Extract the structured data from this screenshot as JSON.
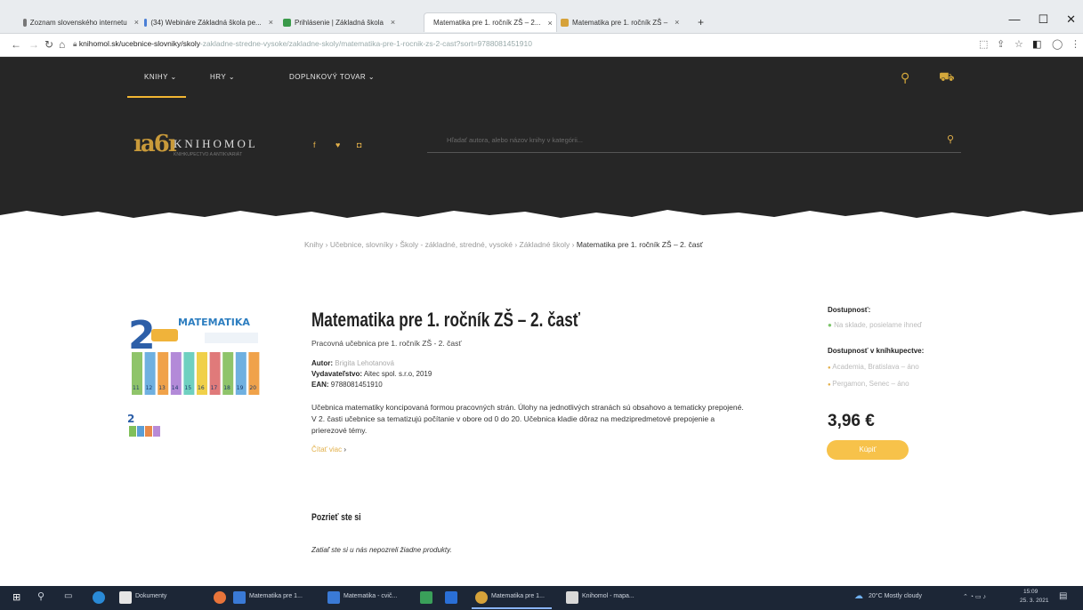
{
  "browser": {
    "tabs": [
      {
        "label": "Zoznam slovenského internetu"
      },
      {
        "label": "(34) Webináre Základná škola pe..."
      },
      {
        "label": "Prihlásenie | Základná škola"
      },
      {
        "label": "Matematika pre 1. ročník ZŠ – 2..."
      },
      {
        "label": "Matematika pre 1. ročník ZŠ –"
      }
    ],
    "new_tab": "+",
    "url": {
      "host": "knihomol.sk",
      "path": "/ucebnice-slovniky/skoly",
      "rest": "-zakladne-stredne-vysoke/zakladne-skoly/matematika-pre-1-rocnik-zs-2-cast?sort=9788081451910"
    },
    "window_controls": [
      "—",
      "☐",
      "✕"
    ]
  },
  "site": {
    "nav": [
      "KNIHY",
      "HRY",
      "DOPLNKOVÝ TOVAR"
    ],
    "logo_mark": "ıa6ı",
    "logo_text": "KNIHOMOL",
    "logo_sub": "KNIHKUPECTVO A ANTIKVARIÁT",
    "search_placeholder": "Hľadať autora, alebo názov knihy v kategórii...",
    "social": [
      "f",
      "♥",
      "◘"
    ]
  },
  "breadcrumb": {
    "items": [
      "Knihy",
      "Učebnice, slovníky",
      "Školy - základné, stredné, vysoké",
      "Základné školy"
    ],
    "current": "Matematika pre 1. ročník ZŠ – 2. časť",
    "sep": "›"
  },
  "product": {
    "title": "Matematika pre 1. ročník ZŠ – 2. časť",
    "subtitle": "Pracovná učebnica pre 1. ročník ZŠ - 2. časť",
    "author_label": "Autor:",
    "author": "Brigita Lehotanová",
    "publisher_label": "Vydavateľstvo:",
    "publisher": "Aitec spol. s.r.o, 2019",
    "ean_label": "EAN:",
    "ean": "9788081451910",
    "description": "Učebnica matematiky koncipovaná formou pracovných strán. Úlohy na jednotlivých stranách sú obsahovo a tematicky prepojené. V 2. časti učebnice sa tematizujú počítanie v obore od 0 do 20. Učebnica kladie dôraz na medzipredmetové prepojenie a prierezové témy.",
    "more": "Čítať viac",
    "cover_title": "MATEMATIKA",
    "cover_number": "2",
    "cover_numbers": [
      "11",
      "12",
      "13",
      "14",
      "15",
      "16",
      "17",
      "18",
      "19",
      "20"
    ]
  },
  "sidebar": {
    "availability_label": "Dostupnosť:",
    "availability_value": "Na sklade, posielame ihneď",
    "stores_label": "Dostupnosť v kníhkupectve:",
    "stores": [
      "Academia, Bratislava – áno",
      "Pergamon, Senec – áno"
    ],
    "price": "3,96 €",
    "buy": "Kúpiť"
  },
  "related": {
    "heading": "Pozrieť ste si",
    "text": "Zatiaľ ste si u nás nepozreli žiadne produkty."
  },
  "taskbar": {
    "items": [
      "Dokumenty",
      "Matematika pre 1...",
      "Matematika - cvič...",
      "Matematika pre 1...",
      "Knihomol - mapa..."
    ],
    "weather": "20°C Mostly cloudy",
    "time": "15:09",
    "date": "25. 3. 2021"
  },
  "colors": {
    "accent": "#f2b632",
    "header": "#262626",
    "taskbar": "#1c2636"
  }
}
